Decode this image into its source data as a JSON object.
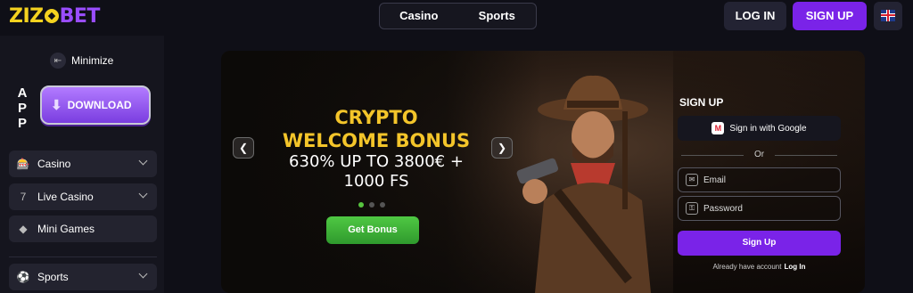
{
  "logo": {
    "part1": "ZIZ",
    "part2": "BET"
  },
  "topnav": {
    "tabs": [
      "Casino",
      "Sports"
    ],
    "login": "LOG IN",
    "signup": "SIGN UP"
  },
  "sidebar": {
    "minimize": "Minimize",
    "app_label": [
      "A",
      "P",
      "P"
    ],
    "download": "DOWNLOAD",
    "items": [
      {
        "label": "Casino",
        "icon": "slot-machine-icon"
      },
      {
        "label": "Live Casino",
        "icon": "live-seven-icon"
      },
      {
        "label": "Mini Games",
        "icon": "diamond-icon"
      },
      {
        "label": "Sports",
        "icon": "football-icon"
      }
    ]
  },
  "banner": {
    "title_line1": "CRYPTO",
    "title_line2": "WELCOME BONUS",
    "sub_line1": "630% UP TO 3800€ +",
    "sub_line2": "1000 FS",
    "cta": "Get Bonus",
    "active_slide": 1,
    "slides": 3
  },
  "signup_form": {
    "title": "SIGN UP",
    "google": "Sign in with Google",
    "or": "Or",
    "email_placeholder": "Email",
    "password_placeholder": "Password",
    "submit": "Sign Up",
    "already": "Already have account",
    "login_link": "Log In"
  },
  "colors": {
    "accent": "#7a23e8",
    "gold": "#f4c52a",
    "green": "#4fc843"
  }
}
